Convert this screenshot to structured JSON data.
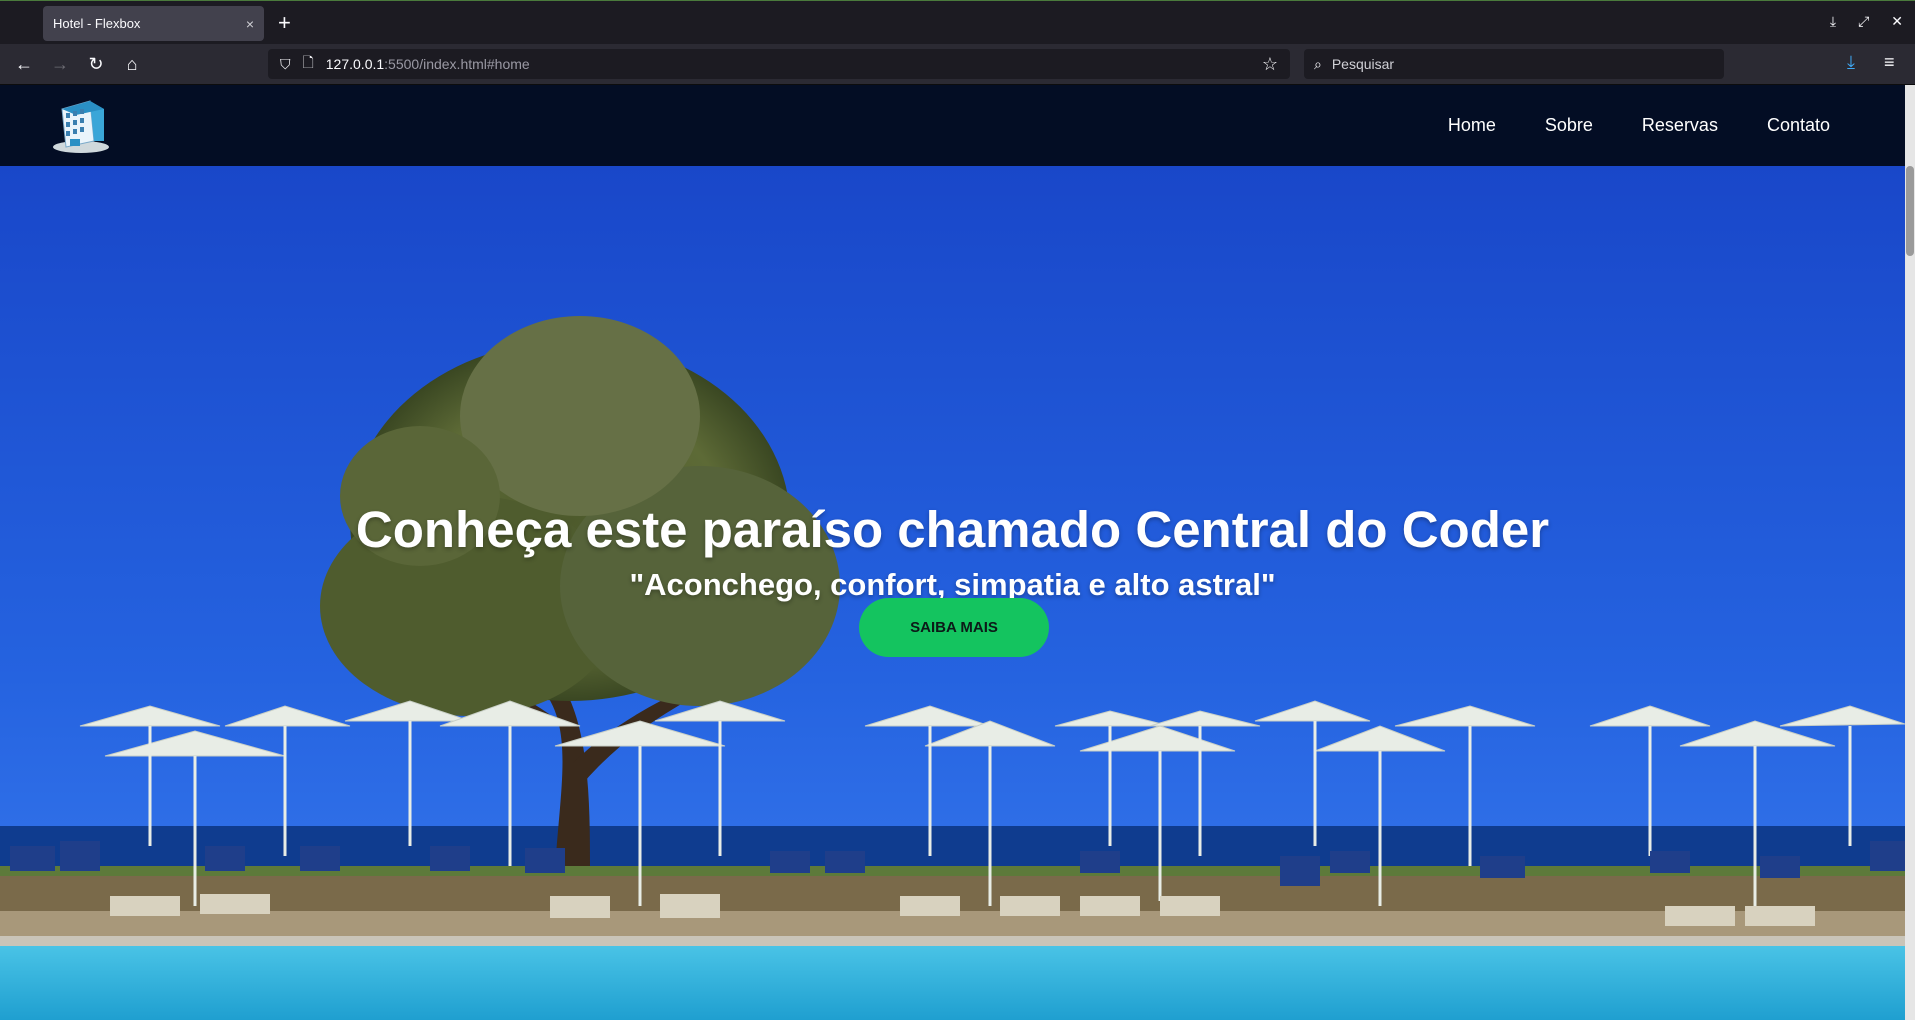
{
  "browser": {
    "tab_title": "Hotel - Flexbox",
    "tab_close": "×",
    "new_tab": "+",
    "url_host": "127.0.0.1",
    "url_path": ":5500/index.html#home",
    "search_placeholder": "Pesquisar",
    "icons": {
      "back": "←",
      "forward": "→",
      "reload": "↻",
      "home": "⌂",
      "shield": "⛉",
      "page": "🗋",
      "star": "☆",
      "search": "⌕",
      "download": "⤓",
      "menu": "≡",
      "minimize": "⤓",
      "maximize": "⤢",
      "close": "✕"
    }
  },
  "site": {
    "nav": [
      "Home",
      "Sobre",
      "Reservas",
      "Contato"
    ],
    "hero": {
      "title": "Conheça este paraíso chamado Central do Coder",
      "subtitle": "\"Aconchego, confort, simpatia e alto astral\"",
      "cta": "SAIBA MAIS"
    },
    "colors": {
      "header_bg": "#030d24",
      "sky": "#1d4fd4",
      "cta_bg": "#14c45f"
    }
  }
}
